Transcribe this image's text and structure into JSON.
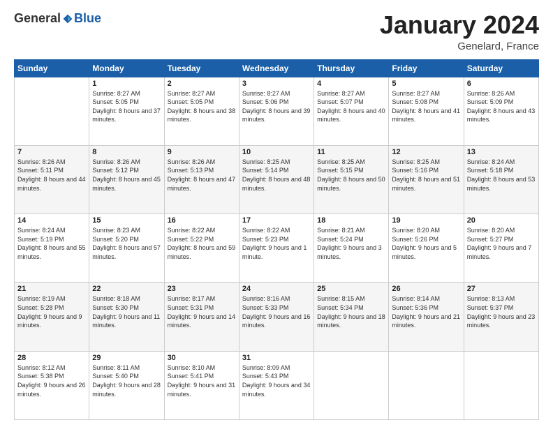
{
  "header": {
    "logo": {
      "general": "General",
      "blue": "Blue"
    },
    "title": "January 2024",
    "location": "Genelard, France"
  },
  "days_of_week": [
    "Sunday",
    "Monday",
    "Tuesday",
    "Wednesday",
    "Thursday",
    "Friday",
    "Saturday"
  ],
  "weeks": [
    [
      {
        "day": "",
        "sunrise": "",
        "sunset": "",
        "daylight": ""
      },
      {
        "day": "1",
        "sunrise": "Sunrise: 8:27 AM",
        "sunset": "Sunset: 5:05 PM",
        "daylight": "Daylight: 8 hours and 37 minutes."
      },
      {
        "day": "2",
        "sunrise": "Sunrise: 8:27 AM",
        "sunset": "Sunset: 5:05 PM",
        "daylight": "Daylight: 8 hours and 38 minutes."
      },
      {
        "day": "3",
        "sunrise": "Sunrise: 8:27 AM",
        "sunset": "Sunset: 5:06 PM",
        "daylight": "Daylight: 8 hours and 39 minutes."
      },
      {
        "day": "4",
        "sunrise": "Sunrise: 8:27 AM",
        "sunset": "Sunset: 5:07 PM",
        "daylight": "Daylight: 8 hours and 40 minutes."
      },
      {
        "day": "5",
        "sunrise": "Sunrise: 8:27 AM",
        "sunset": "Sunset: 5:08 PM",
        "daylight": "Daylight: 8 hours and 41 minutes."
      },
      {
        "day": "6",
        "sunrise": "Sunrise: 8:26 AM",
        "sunset": "Sunset: 5:09 PM",
        "daylight": "Daylight: 8 hours and 43 minutes."
      }
    ],
    [
      {
        "day": "7",
        "sunrise": "Sunrise: 8:26 AM",
        "sunset": "Sunset: 5:11 PM",
        "daylight": "Daylight: 8 hours and 44 minutes."
      },
      {
        "day": "8",
        "sunrise": "Sunrise: 8:26 AM",
        "sunset": "Sunset: 5:12 PM",
        "daylight": "Daylight: 8 hours and 45 minutes."
      },
      {
        "day": "9",
        "sunrise": "Sunrise: 8:26 AM",
        "sunset": "Sunset: 5:13 PM",
        "daylight": "Daylight: 8 hours and 47 minutes."
      },
      {
        "day": "10",
        "sunrise": "Sunrise: 8:25 AM",
        "sunset": "Sunset: 5:14 PM",
        "daylight": "Daylight: 8 hours and 48 minutes."
      },
      {
        "day": "11",
        "sunrise": "Sunrise: 8:25 AM",
        "sunset": "Sunset: 5:15 PM",
        "daylight": "Daylight: 8 hours and 50 minutes."
      },
      {
        "day": "12",
        "sunrise": "Sunrise: 8:25 AM",
        "sunset": "Sunset: 5:16 PM",
        "daylight": "Daylight: 8 hours and 51 minutes."
      },
      {
        "day": "13",
        "sunrise": "Sunrise: 8:24 AM",
        "sunset": "Sunset: 5:18 PM",
        "daylight": "Daylight: 8 hours and 53 minutes."
      }
    ],
    [
      {
        "day": "14",
        "sunrise": "Sunrise: 8:24 AM",
        "sunset": "Sunset: 5:19 PM",
        "daylight": "Daylight: 8 hours and 55 minutes."
      },
      {
        "day": "15",
        "sunrise": "Sunrise: 8:23 AM",
        "sunset": "Sunset: 5:20 PM",
        "daylight": "Daylight: 8 hours and 57 minutes."
      },
      {
        "day": "16",
        "sunrise": "Sunrise: 8:22 AM",
        "sunset": "Sunset: 5:22 PM",
        "daylight": "Daylight: 8 hours and 59 minutes."
      },
      {
        "day": "17",
        "sunrise": "Sunrise: 8:22 AM",
        "sunset": "Sunset: 5:23 PM",
        "daylight": "Daylight: 9 hours and 1 minute."
      },
      {
        "day": "18",
        "sunrise": "Sunrise: 8:21 AM",
        "sunset": "Sunset: 5:24 PM",
        "daylight": "Daylight: 9 hours and 3 minutes."
      },
      {
        "day": "19",
        "sunrise": "Sunrise: 8:20 AM",
        "sunset": "Sunset: 5:26 PM",
        "daylight": "Daylight: 9 hours and 5 minutes."
      },
      {
        "day": "20",
        "sunrise": "Sunrise: 8:20 AM",
        "sunset": "Sunset: 5:27 PM",
        "daylight": "Daylight: 9 hours and 7 minutes."
      }
    ],
    [
      {
        "day": "21",
        "sunrise": "Sunrise: 8:19 AM",
        "sunset": "Sunset: 5:28 PM",
        "daylight": "Daylight: 9 hours and 9 minutes."
      },
      {
        "day": "22",
        "sunrise": "Sunrise: 8:18 AM",
        "sunset": "Sunset: 5:30 PM",
        "daylight": "Daylight: 9 hours and 11 minutes."
      },
      {
        "day": "23",
        "sunrise": "Sunrise: 8:17 AM",
        "sunset": "Sunset: 5:31 PM",
        "daylight": "Daylight: 9 hours and 14 minutes."
      },
      {
        "day": "24",
        "sunrise": "Sunrise: 8:16 AM",
        "sunset": "Sunset: 5:33 PM",
        "daylight": "Daylight: 9 hours and 16 minutes."
      },
      {
        "day": "25",
        "sunrise": "Sunrise: 8:15 AM",
        "sunset": "Sunset: 5:34 PM",
        "daylight": "Daylight: 9 hours and 18 minutes."
      },
      {
        "day": "26",
        "sunrise": "Sunrise: 8:14 AM",
        "sunset": "Sunset: 5:36 PM",
        "daylight": "Daylight: 9 hours and 21 minutes."
      },
      {
        "day": "27",
        "sunrise": "Sunrise: 8:13 AM",
        "sunset": "Sunset: 5:37 PM",
        "daylight": "Daylight: 9 hours and 23 minutes."
      }
    ],
    [
      {
        "day": "28",
        "sunrise": "Sunrise: 8:12 AM",
        "sunset": "Sunset: 5:38 PM",
        "daylight": "Daylight: 9 hours and 26 minutes."
      },
      {
        "day": "29",
        "sunrise": "Sunrise: 8:11 AM",
        "sunset": "Sunset: 5:40 PM",
        "daylight": "Daylight: 9 hours and 28 minutes."
      },
      {
        "day": "30",
        "sunrise": "Sunrise: 8:10 AM",
        "sunset": "Sunset: 5:41 PM",
        "daylight": "Daylight: 9 hours and 31 minutes."
      },
      {
        "day": "31",
        "sunrise": "Sunrise: 8:09 AM",
        "sunset": "Sunset: 5:43 PM",
        "daylight": "Daylight: 9 hours and 34 minutes."
      },
      {
        "day": "",
        "sunrise": "",
        "sunset": "",
        "daylight": ""
      },
      {
        "day": "",
        "sunrise": "",
        "sunset": "",
        "daylight": ""
      },
      {
        "day": "",
        "sunrise": "",
        "sunset": "",
        "daylight": ""
      }
    ]
  ]
}
